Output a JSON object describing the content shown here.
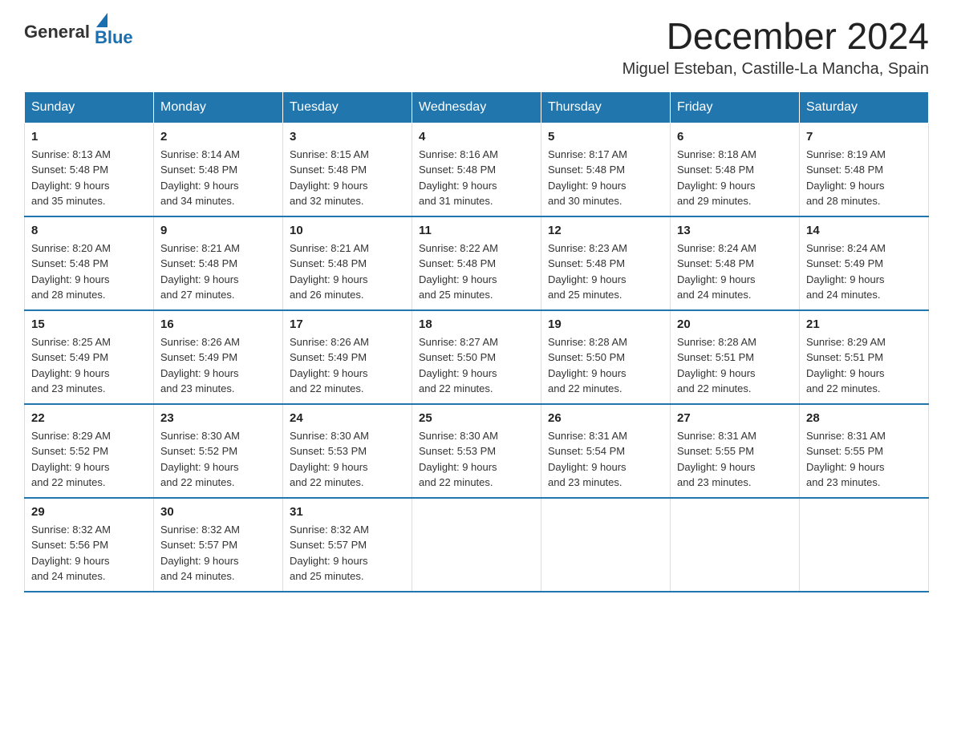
{
  "header": {
    "logo_general": "General",
    "logo_blue": "Blue",
    "month_title": "December 2024",
    "location": "Miguel Esteban, Castille-La Mancha, Spain"
  },
  "weekdays": [
    "Sunday",
    "Monday",
    "Tuesday",
    "Wednesday",
    "Thursday",
    "Friday",
    "Saturday"
  ],
  "weeks": [
    [
      {
        "day": "1",
        "sunrise": "8:13 AM",
        "sunset": "5:48 PM",
        "daylight": "9 hours and 35 minutes."
      },
      {
        "day": "2",
        "sunrise": "8:14 AM",
        "sunset": "5:48 PM",
        "daylight": "9 hours and 34 minutes."
      },
      {
        "day": "3",
        "sunrise": "8:15 AM",
        "sunset": "5:48 PM",
        "daylight": "9 hours and 32 minutes."
      },
      {
        "day": "4",
        "sunrise": "8:16 AM",
        "sunset": "5:48 PM",
        "daylight": "9 hours and 31 minutes."
      },
      {
        "day": "5",
        "sunrise": "8:17 AM",
        "sunset": "5:48 PM",
        "daylight": "9 hours and 30 minutes."
      },
      {
        "day": "6",
        "sunrise": "8:18 AM",
        "sunset": "5:48 PM",
        "daylight": "9 hours and 29 minutes."
      },
      {
        "day": "7",
        "sunrise": "8:19 AM",
        "sunset": "5:48 PM",
        "daylight": "9 hours and 28 minutes."
      }
    ],
    [
      {
        "day": "8",
        "sunrise": "8:20 AM",
        "sunset": "5:48 PM",
        "daylight": "9 hours and 28 minutes."
      },
      {
        "day": "9",
        "sunrise": "8:21 AM",
        "sunset": "5:48 PM",
        "daylight": "9 hours and 27 minutes."
      },
      {
        "day": "10",
        "sunrise": "8:21 AM",
        "sunset": "5:48 PM",
        "daylight": "9 hours and 26 minutes."
      },
      {
        "day": "11",
        "sunrise": "8:22 AM",
        "sunset": "5:48 PM",
        "daylight": "9 hours and 25 minutes."
      },
      {
        "day": "12",
        "sunrise": "8:23 AM",
        "sunset": "5:48 PM",
        "daylight": "9 hours and 25 minutes."
      },
      {
        "day": "13",
        "sunrise": "8:24 AM",
        "sunset": "5:48 PM",
        "daylight": "9 hours and 24 minutes."
      },
      {
        "day": "14",
        "sunrise": "8:24 AM",
        "sunset": "5:49 PM",
        "daylight": "9 hours and 24 minutes."
      }
    ],
    [
      {
        "day": "15",
        "sunrise": "8:25 AM",
        "sunset": "5:49 PM",
        "daylight": "9 hours and 23 minutes."
      },
      {
        "day": "16",
        "sunrise": "8:26 AM",
        "sunset": "5:49 PM",
        "daylight": "9 hours and 23 minutes."
      },
      {
        "day": "17",
        "sunrise": "8:26 AM",
        "sunset": "5:49 PM",
        "daylight": "9 hours and 22 minutes."
      },
      {
        "day": "18",
        "sunrise": "8:27 AM",
        "sunset": "5:50 PM",
        "daylight": "9 hours and 22 minutes."
      },
      {
        "day": "19",
        "sunrise": "8:28 AM",
        "sunset": "5:50 PM",
        "daylight": "9 hours and 22 minutes."
      },
      {
        "day": "20",
        "sunrise": "8:28 AM",
        "sunset": "5:51 PM",
        "daylight": "9 hours and 22 minutes."
      },
      {
        "day": "21",
        "sunrise": "8:29 AM",
        "sunset": "5:51 PM",
        "daylight": "9 hours and 22 minutes."
      }
    ],
    [
      {
        "day": "22",
        "sunrise": "8:29 AM",
        "sunset": "5:52 PM",
        "daylight": "9 hours and 22 minutes."
      },
      {
        "day": "23",
        "sunrise": "8:30 AM",
        "sunset": "5:52 PM",
        "daylight": "9 hours and 22 minutes."
      },
      {
        "day": "24",
        "sunrise": "8:30 AM",
        "sunset": "5:53 PM",
        "daylight": "9 hours and 22 minutes."
      },
      {
        "day": "25",
        "sunrise": "8:30 AM",
        "sunset": "5:53 PM",
        "daylight": "9 hours and 22 minutes."
      },
      {
        "day": "26",
        "sunrise": "8:31 AM",
        "sunset": "5:54 PM",
        "daylight": "9 hours and 23 minutes."
      },
      {
        "day": "27",
        "sunrise": "8:31 AM",
        "sunset": "5:55 PM",
        "daylight": "9 hours and 23 minutes."
      },
      {
        "day": "28",
        "sunrise": "8:31 AM",
        "sunset": "5:55 PM",
        "daylight": "9 hours and 23 minutes."
      }
    ],
    [
      {
        "day": "29",
        "sunrise": "8:32 AM",
        "sunset": "5:56 PM",
        "daylight": "9 hours and 24 minutes."
      },
      {
        "day": "30",
        "sunrise": "8:32 AM",
        "sunset": "5:57 PM",
        "daylight": "9 hours and 24 minutes."
      },
      {
        "day": "31",
        "sunrise": "8:32 AM",
        "sunset": "5:57 PM",
        "daylight": "9 hours and 25 minutes."
      },
      null,
      null,
      null,
      null
    ]
  ],
  "labels": {
    "sunrise": "Sunrise:",
    "sunset": "Sunset:",
    "daylight": "Daylight:"
  }
}
